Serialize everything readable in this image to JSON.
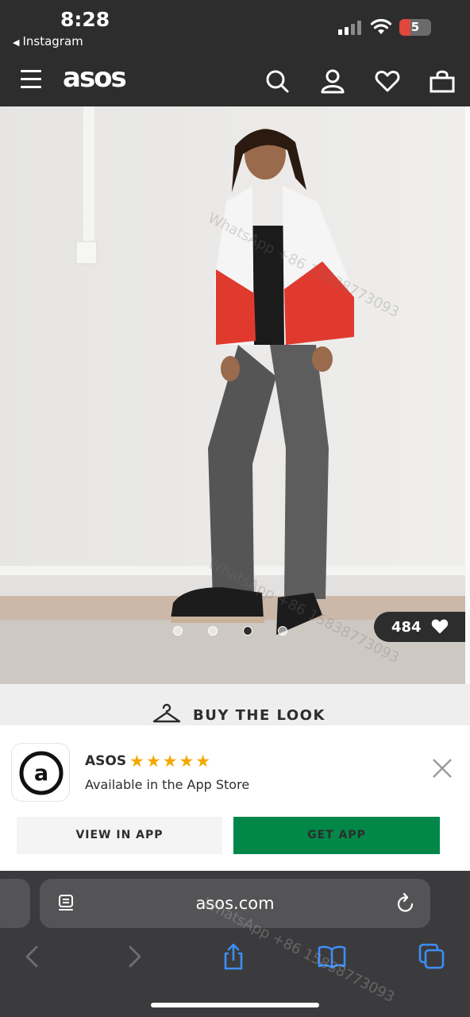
{
  "status_bar": {
    "time": "8:28",
    "back_label": "Instagram",
    "battery": "5"
  },
  "header": {
    "logo": "asos",
    "icons": [
      "menu-icon",
      "search-icon",
      "account-icon",
      "heart-icon",
      "bag-icon"
    ]
  },
  "hero": {
    "like_count": "484",
    "carousel": {
      "total": 4,
      "active_index": 2
    }
  },
  "buy_the_look": {
    "label": "BUY THE LOOK"
  },
  "app_banner": {
    "app_name": "ASOS",
    "rating_stars": "★★★★★",
    "subtitle": "Available in the App Store",
    "view_button": "VIEW IN APP",
    "get_button": "GET APP"
  },
  "browser": {
    "url": "asos.com"
  },
  "watermark": "WhatsApp +86 15838773093",
  "colors": {
    "header_bg": "#2d2d2d",
    "get_app_green": "#018849",
    "star": "#f2a900",
    "safari_bg": "#3b3b3d"
  }
}
